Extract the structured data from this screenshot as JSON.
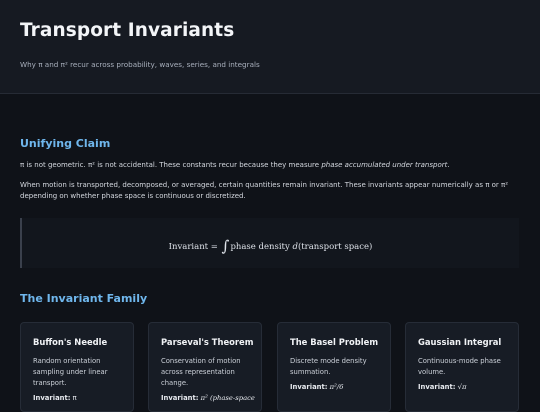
{
  "header": {
    "title": "Transport Invariants",
    "subtitle": "Why π and π² recur across probability, waves, series, and integrals"
  },
  "claim": {
    "heading": "Unifying Claim",
    "para1_prefix": "π is not geometric. π² is not accidental. These constants recur because they measure ",
    "para1_emphasis": "phase accumulated under transport",
    "para1_suffix": ".",
    "para2": "When motion is transported, decomposed, or averaged, certain quantities remain invariant. These invariants appear numerically as π or π² depending on whether phase space is continuous or discretized."
  },
  "formula": {
    "lhs": "Invariant",
    "equals": "=",
    "integral": "∫",
    "integrand": "phase density",
    "differential": "d",
    "variable": "(transport space)"
  },
  "family": {
    "heading": "The Invariant Family",
    "invariant_label": "Invariant:",
    "cards": [
      {
        "title": "Buffon's Needle",
        "desc": "Random orientation sampling under linear transport.",
        "value": "π"
      },
      {
        "title": "Parseval's Theorem",
        "desc": "Conservation of motion across representation change.",
        "value": "π² (phase-space"
      },
      {
        "title": "The Basel Problem",
        "desc": "Discrete mode density summation.",
        "value": "π²/6"
      },
      {
        "title": "Gaussian Integral",
        "desc": "Continuous-mode phase volume.",
        "value": "√π"
      }
    ]
  }
}
